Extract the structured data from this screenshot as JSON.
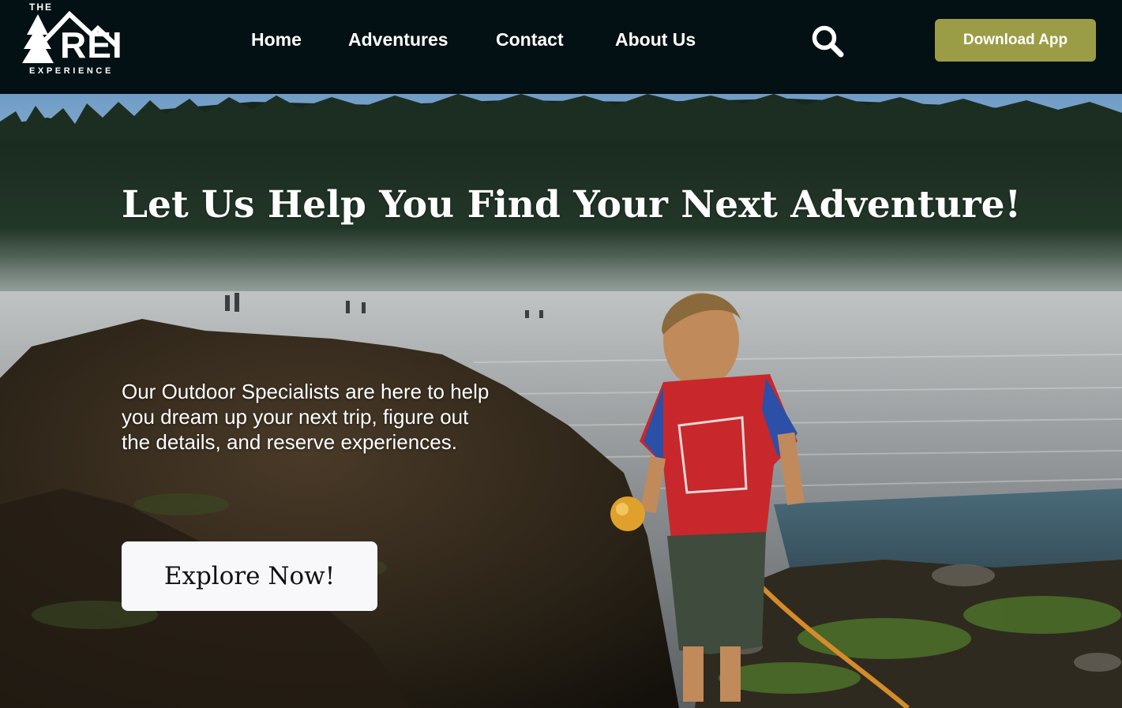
{
  "brand": {
    "top": "THE",
    "main": "REI",
    "bottom": "EXPERIENCE"
  },
  "nav": {
    "items": [
      {
        "label": "Home"
      },
      {
        "label": "Adventures"
      },
      {
        "label": "Contact"
      },
      {
        "label": "About Us"
      }
    ],
    "search_icon": "search-icon",
    "download_label": "Download App"
  },
  "hero": {
    "title": "Let Us Help You Find Your Next Adventure!",
    "description": "Our Outdoor Specialists are here to help you dream up your next trip, figure out the details, and reserve experiences.",
    "cta_label": "Explore Now!"
  },
  "colors": {
    "header_bg": "#031014",
    "accent": "#9b9d46",
    "cta_bg": "#f8f8fb"
  }
}
